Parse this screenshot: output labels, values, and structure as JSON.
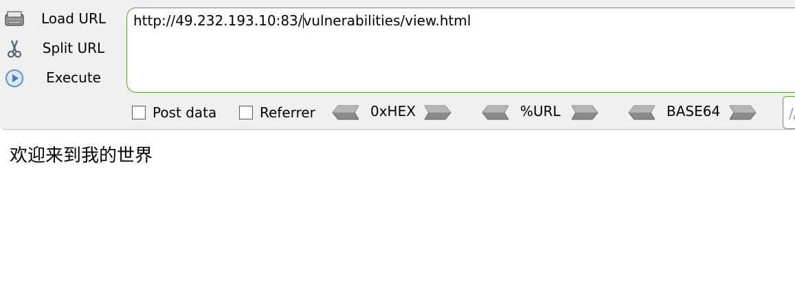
{
  "toolbar": {
    "load_url_label": "Load URL",
    "split_url_label": "Split URL",
    "execute_label": "Execute",
    "url_before_caret": "http://49.232.193.10:83/",
    "url_after_caret": "vulnerabilities/view.html",
    "post_data_label": "Post data",
    "referrer_label": "Referrer",
    "hex_label": "0xHEX",
    "url_encode_label": "%URL",
    "base64_label": "BASE64",
    "extra_field_text": "//"
  },
  "page": {
    "content_text": "欢迎来到我的世界"
  }
}
